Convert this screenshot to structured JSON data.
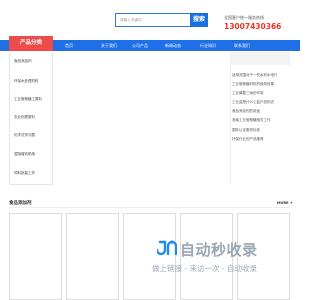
{
  "header": {
    "search_placeholder": "请输入关键词",
    "search_button": "搜索",
    "hotline_label": "全国客户统一服务热线",
    "hotline_number": "13007430366"
  },
  "nav": {
    "items": [
      {
        "label": "首页"
      },
      {
        "label": "关于我们"
      },
      {
        "label": "公司产品"
      },
      {
        "label": "新闻动态"
      },
      {
        "label": "行业知识"
      },
      {
        "label": "联系我们"
      }
    ]
  },
  "category": {
    "title": "产品分类",
    "items": [
      {
        "label": "食品添加剂"
      },
      {
        "label": "环保水处理材料"
      },
      {
        "label": "工业葡萄糖工原料"
      },
      {
        "label": "农业化肥原料"
      },
      {
        "label": "化学试剂与酸"
      },
      {
        "label": "湿阻增效助用"
      },
      {
        "label": "饲料批量工作"
      }
    ]
  },
  "side_news": {
    "items": [
      {
        "label": "适用范围对于一些水利水电行"
      },
      {
        "label": "工业葡萄糖材料的使用效果"
      },
      {
        "label": "工业磷酸三钠的作用"
      },
      {
        "label": "工业盐是什么上盐产品知识"
      },
      {
        "label": "食品添加剂的用途"
      },
      {
        "label": "淮南工业葡萄糖相关工作"
      },
      {
        "label": "国际认证服务标准"
      },
      {
        "label": "环保行业的产品推荐"
      }
    ]
  },
  "products": {
    "title": "食品添加剂",
    "more": "MORE +"
  },
  "watermark": {
    "title": "自动秒收录",
    "slogan": "做上链接 - 来访一次 - 自动收录"
  },
  "colors": {
    "brand_blue": "#1f6fe8",
    "category_red": "#ee4b4b",
    "hotline_red": "#ee3322"
  }
}
